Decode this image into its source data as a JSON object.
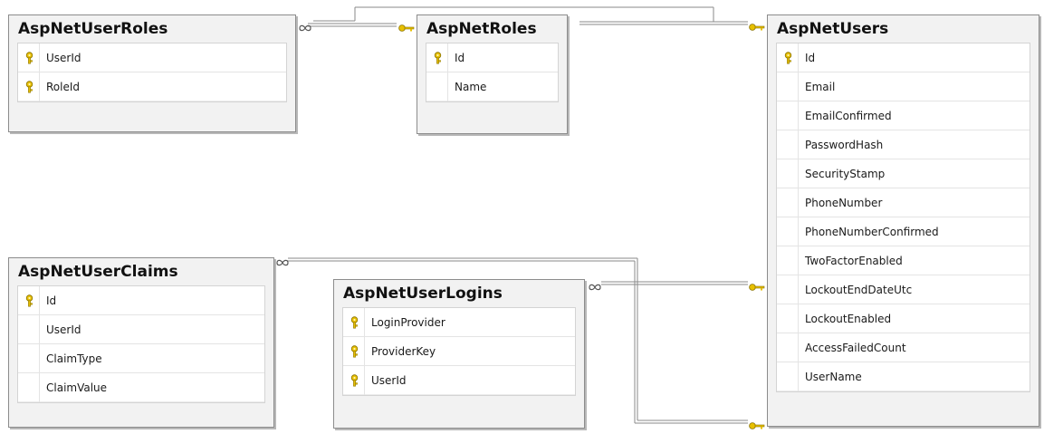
{
  "tables": {
    "aspnetuserroles": {
      "title": "AspNetUserRoles",
      "columns": [
        {
          "name": "UserId",
          "key": true
        },
        {
          "name": "RoleId",
          "key": true
        }
      ]
    },
    "aspnetroles": {
      "title": "AspNetRoles",
      "columns": [
        {
          "name": "Id",
          "key": true
        },
        {
          "name": "Name",
          "key": false
        }
      ]
    },
    "aspnetusers": {
      "title": "AspNetUsers",
      "columns": [
        {
          "name": "Id",
          "key": true
        },
        {
          "name": "Email",
          "key": false
        },
        {
          "name": "EmailConfirmed",
          "key": false
        },
        {
          "name": "PasswordHash",
          "key": false
        },
        {
          "name": "SecurityStamp",
          "key": false
        },
        {
          "name": "PhoneNumber",
          "key": false
        },
        {
          "name": "PhoneNumberConfirmed",
          "key": false
        },
        {
          "name": "TwoFactorEnabled",
          "key": false
        },
        {
          "name": "LockoutEndDateUtc",
          "key": false
        },
        {
          "name": "LockoutEnabled",
          "key": false
        },
        {
          "name": "AccessFailedCount",
          "key": false
        },
        {
          "name": "UserName",
          "key": false
        }
      ]
    },
    "aspnetuserclaims": {
      "title": "AspNetUserClaims",
      "columns": [
        {
          "name": "Id",
          "key": true
        },
        {
          "name": "UserId",
          "key": false
        },
        {
          "name": "ClaimType",
          "key": false
        },
        {
          "name": "ClaimValue",
          "key": false
        }
      ]
    },
    "aspnetuserlogins": {
      "title": "AspNetUserLogins",
      "columns": [
        {
          "name": "LoginProvider",
          "key": true
        },
        {
          "name": "ProviderKey",
          "key": true
        },
        {
          "name": "UserId",
          "key": true
        }
      ]
    }
  },
  "relationships": [
    {
      "many": "AspNetUserRoles",
      "one": "AspNetRoles"
    },
    {
      "many": "AspNetUserRoles",
      "one": "AspNetUsers"
    },
    {
      "many": "AspNetUserClaims",
      "one": "AspNetUsers"
    },
    {
      "many": "AspNetUserLogins",
      "one": "AspNetUsers"
    }
  ],
  "icons": {
    "primary_key": "key-icon",
    "many_end": "infinity-icon",
    "one_end": "key-icon"
  },
  "colors": {
    "key_gold": "#e8c000",
    "table_bg": "#f2f2f2",
    "table_border": "#8c8c8c",
    "connector": "#8a8a8a"
  }
}
